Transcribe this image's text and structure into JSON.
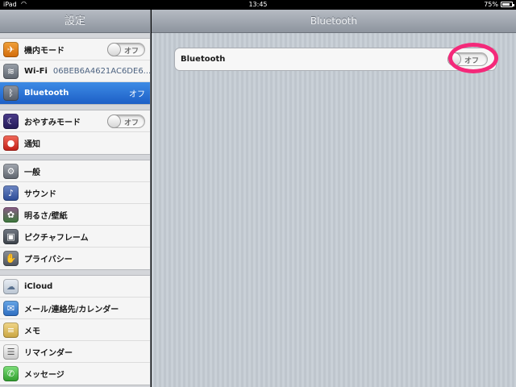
{
  "status_bar": {
    "carrier": "iPad",
    "wifi_icon": "wifi-icon",
    "time": "13:45",
    "battery_pct": "75%",
    "battery_level": 0.75
  },
  "sidebar": {
    "title": "設定",
    "groups": [
      [
        {
          "key": "airplane",
          "label": "機内モード",
          "icon": "airplane-icon",
          "toggle": "オフ"
        },
        {
          "key": "wifi",
          "label": "Wi-Fi",
          "icon": "wifi-icon",
          "sub": "06BEB6A4621AC6DE6..."
        },
        {
          "key": "bluetooth",
          "label": "Bluetooth",
          "icon": "bluetooth-icon",
          "value": "オフ",
          "selected": true
        }
      ],
      [
        {
          "key": "dnd",
          "label": "おやすみモード",
          "icon": "moon-icon",
          "toggle": "オフ"
        },
        {
          "key": "notifications",
          "label": "通知",
          "icon": "notification-icon"
        }
      ],
      [
        {
          "key": "general",
          "label": "一般",
          "icon": "gear-icon"
        },
        {
          "key": "sound",
          "label": "サウンド",
          "icon": "speaker-icon"
        },
        {
          "key": "brightness",
          "label": "明るさ/壁紙",
          "icon": "flower-icon"
        },
        {
          "key": "picture-frame",
          "label": "ピクチャフレーム",
          "icon": "picture-frame-icon"
        },
        {
          "key": "privacy",
          "label": "プライバシー",
          "icon": "hand-icon"
        }
      ],
      [
        {
          "key": "icloud",
          "label": "iCloud",
          "icon": "cloud-icon"
        },
        {
          "key": "mail",
          "label": "メール/連絡先/カレンダー",
          "icon": "mail-icon"
        },
        {
          "key": "notes",
          "label": "メモ",
          "icon": "notes-icon"
        },
        {
          "key": "reminders",
          "label": "リマインダー",
          "icon": "reminders-icon"
        },
        {
          "key": "messages",
          "label": "メッセージ",
          "icon": "messages-icon"
        }
      ]
    ]
  },
  "main": {
    "title": "Bluetooth",
    "bluetooth_label": "Bluetooth",
    "bluetooth_toggle": "オフ",
    "highlight_color": "#f4297a"
  },
  "colors": {
    "selected_row": "#1d5fc6",
    "toggle_off_text": "#6a6a6a"
  }
}
